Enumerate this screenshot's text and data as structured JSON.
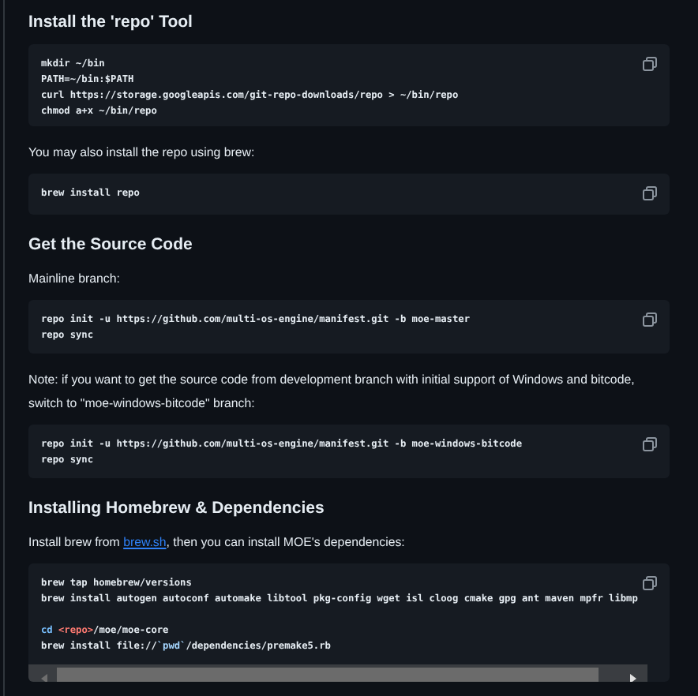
{
  "blocks": [
    {
      "kind": "heading",
      "text": "Install the 'repo' Tool"
    },
    {
      "kind": "code",
      "groups": [
        [
          [
            "mkdir ~/bin"
          ],
          [
            "PATH=~/bin:$PATH"
          ],
          [
            "curl https://storage.googleapis.com/git-repo-downloads/repo > ~/bin/repo"
          ],
          [
            "chmod a+x ~/bin/repo"
          ]
        ]
      ]
    },
    {
      "kind": "paragraph",
      "parts": [
        {
          "kind": "text",
          "text": "You may also install the repo using brew:"
        }
      ]
    },
    {
      "kind": "code",
      "groups": [
        [
          [
            "brew install repo"
          ]
        ]
      ]
    },
    {
      "kind": "heading",
      "text": "Get the Source Code"
    },
    {
      "kind": "paragraph",
      "parts": [
        {
          "kind": "text",
          "text": "Mainline branch:"
        }
      ]
    },
    {
      "kind": "code",
      "groups": [
        [
          [
            "repo init -u https://github.com/multi-os-engine/manifest.git -b moe-master"
          ],
          [
            "repo sync"
          ]
        ]
      ]
    },
    {
      "kind": "paragraph",
      "parts": [
        {
          "kind": "text",
          "text": "Note: if you want to get the source code from development branch with initial support of Windows and bitcode, switch to \"moe-windows-bitcode\" branch:"
        }
      ]
    },
    {
      "kind": "code",
      "groups": [
        [
          [
            "repo init -u https://github.com/multi-os-engine/manifest.git -b moe-windows-bitcode"
          ],
          [
            "repo sync"
          ]
        ]
      ]
    },
    {
      "kind": "heading",
      "text": "Installing Homebrew & Dependencies"
    },
    {
      "kind": "paragraph",
      "parts": [
        {
          "kind": "text",
          "text": "Install brew from "
        },
        {
          "kind": "link",
          "text": "brew.sh"
        },
        {
          "kind": "text",
          "text": ", then you can install MOE's dependencies:"
        }
      ]
    },
    {
      "kind": "code",
      "scroll": true,
      "groups": [
        [
          [
            "brew tap homebrew/versions"
          ],
          [
            "brew install autogen autoconf automake libtool pkg-config wget isl cloog cmake gpg ant maven mpfr libmp"
          ]
        ],
        [
          [
            {
              "text": "cd ",
              "kind": "builtin"
            },
            {
              "text": "<repo>",
              "kind": "placeholder"
            },
            {
              "text": "/moe/moe-core",
              "kind": "plain"
            }
          ],
          [
            {
              "text": "brew install file://",
              "kind": "plain"
            },
            {
              "text": "`pwd`",
              "kind": "subst"
            },
            {
              "text": "/dependencies/premake5.rb",
              "kind": "plain"
            }
          ]
        ]
      ]
    }
  ]
}
